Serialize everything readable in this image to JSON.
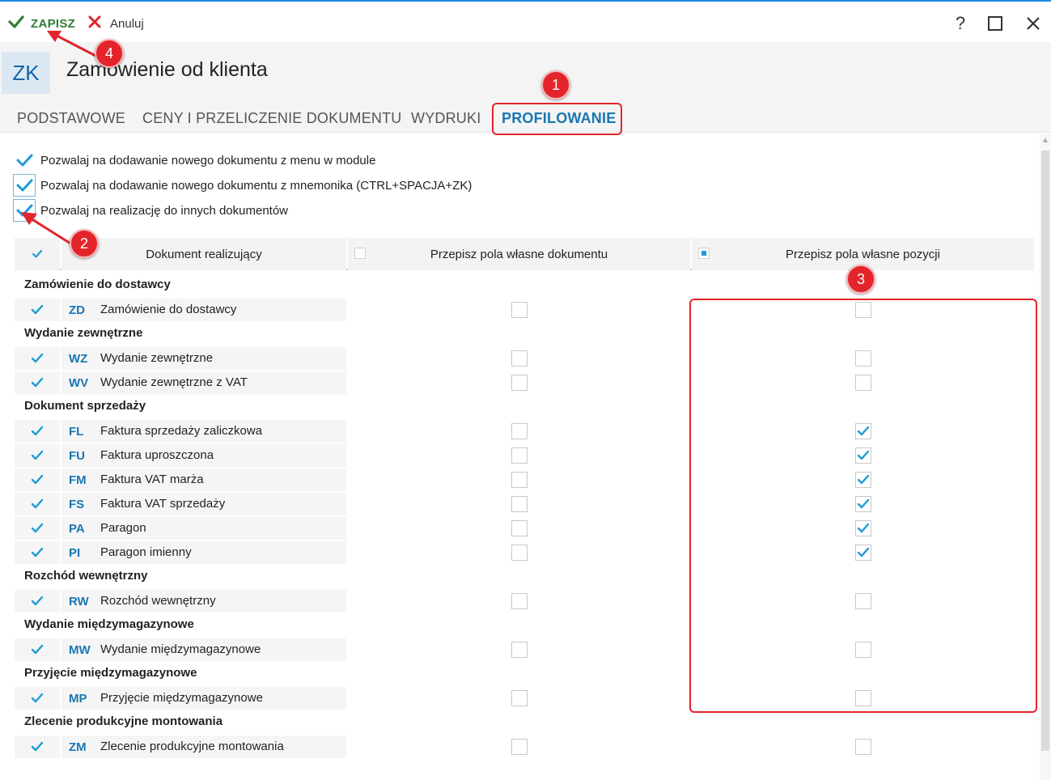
{
  "toolbar": {
    "save_label": "ZAPISZ",
    "cancel_label": "Anuluj",
    "help_label": "?"
  },
  "header": {
    "badge": "ZK",
    "title": "Zamówienie od klienta"
  },
  "tabs": [
    {
      "label": "PODSTAWOWE",
      "active": false
    },
    {
      "label": "CENY I PRZELICZENIE DOKUMENTU",
      "active": false
    },
    {
      "label": "WYDRUKI",
      "active": false
    },
    {
      "label": "PROFILOWANIE",
      "active": true
    }
  ],
  "options": [
    {
      "label": "Pozwalaj na dodawanie nowego dokumentu z menu w module",
      "checked": true
    },
    {
      "label": "Pozwalaj na dodawanie nowego dokumentu z mnemonika (CTRL+SPACJA+ZK)",
      "checked": true
    },
    {
      "label": "Pozwalaj na realizację do innych dokumentów",
      "checked": true
    }
  ],
  "table": {
    "columns": [
      "Dokument realizujący",
      "Przepisz pola własne dokumentu",
      "Przepisz pola własne pozycji"
    ],
    "groups": [
      {
        "name": "Zamówienie do dostawcy",
        "rows": [
          {
            "symbol": "ZD",
            "name": "Zamówienie do dostawcy",
            "selected": true,
            "copy_doc": false,
            "copy_pos": false
          }
        ]
      },
      {
        "name": "Wydanie zewnętrzne",
        "rows": [
          {
            "symbol": "WZ",
            "name": "Wydanie zewnętrzne",
            "selected": true,
            "copy_doc": false,
            "copy_pos": false
          },
          {
            "symbol": "WV",
            "name": "Wydanie zewnętrzne z VAT",
            "selected": true,
            "copy_doc": false,
            "copy_pos": false
          }
        ]
      },
      {
        "name": "Dokument sprzedaży",
        "rows": [
          {
            "symbol": "FL",
            "name": "Faktura sprzedaży zaliczkowa",
            "selected": true,
            "copy_doc": false,
            "copy_pos": true
          },
          {
            "symbol": "FU",
            "name": "Faktura uproszczona",
            "selected": true,
            "copy_doc": false,
            "copy_pos": true
          },
          {
            "symbol": "FM",
            "name": "Faktura VAT marża",
            "selected": true,
            "copy_doc": false,
            "copy_pos": true
          },
          {
            "symbol": "FS",
            "name": "Faktura VAT sprzedaży",
            "selected": true,
            "copy_doc": false,
            "copy_pos": true
          },
          {
            "symbol": "PA",
            "name": "Paragon",
            "selected": true,
            "copy_doc": false,
            "copy_pos": true
          },
          {
            "symbol": "PI",
            "name": "Paragon imienny",
            "selected": true,
            "copy_doc": false,
            "copy_pos": true
          }
        ]
      },
      {
        "name": "Rozchód wewnętrzny",
        "rows": [
          {
            "symbol": "RW",
            "name": "Rozchód wewnętrzny",
            "selected": true,
            "copy_doc": false,
            "copy_pos": false
          }
        ]
      },
      {
        "name": "Wydanie międzymagazynowe",
        "rows": [
          {
            "symbol": "MW",
            "name": "Wydanie międzymagazynowe",
            "selected": true,
            "copy_doc": false,
            "copy_pos": false
          }
        ]
      },
      {
        "name": "Przyjęcie międzymagazynowe",
        "rows": [
          {
            "symbol": "MP",
            "name": "Przyjęcie międzymagazynowe",
            "selected": true,
            "copy_doc": false,
            "copy_pos": false
          }
        ]
      },
      {
        "name": "Zlecenie produkcyjne montowania",
        "rows": [
          {
            "symbol": "ZM",
            "name": "Zlecenie produkcyjne montowania",
            "selected": true,
            "copy_doc": false,
            "copy_pos": false
          }
        ]
      }
    ]
  },
  "annotations": [
    "1",
    "2",
    "3",
    "4"
  ],
  "colors": {
    "accent": "#1976b3",
    "check": "#1e9ad6",
    "save": "#2e7d32",
    "cancel": "#e3242b",
    "annotation": "#e3242b"
  },
  "icons": [
    "checkmark-icon",
    "cross-icon",
    "help-icon",
    "maximize-icon",
    "close-icon"
  ]
}
